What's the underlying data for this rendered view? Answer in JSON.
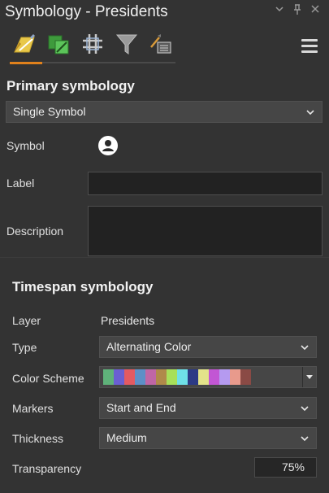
{
  "window": {
    "title": "Symbology - Presidents",
    "buttons": [
      "chevron-down-icon",
      "pin-icon",
      "close-icon"
    ]
  },
  "toolbar": {
    "tabs": [
      {
        "name": "primary-symbology-tab",
        "active": true
      },
      {
        "name": "secondary-symbology-tab",
        "active": false
      },
      {
        "name": "vary-symbology-tab",
        "active": false
      },
      {
        "name": "symbol-filter-tab",
        "active": false
      },
      {
        "name": "symbol-layer-drawing-tab",
        "active": false
      }
    ],
    "accent_color": "#e0811c"
  },
  "primary": {
    "heading": "Primary symbology",
    "method": "Single Symbol",
    "symbol_label": "Symbol",
    "label_label": "Label",
    "label_value": "",
    "description_label": "Description",
    "description_value": ""
  },
  "timespan": {
    "heading": "Timespan symbology",
    "layer_label": "Layer",
    "layer_value": "Presidents",
    "type_label": "Type",
    "type_value": "Alternating Color",
    "color_scheme_label": "Color Scheme",
    "color_scheme_swatches": [
      "#5fb27a",
      "#6a5fd2",
      "#e35a62",
      "#5d8fc7",
      "#c066a6",
      "#b08a4a",
      "#a7e05a",
      "#6fe0e8",
      "#2c3a85",
      "#e3e38a",
      "#c256d4",
      "#b59af0",
      "#e89a8c",
      "#8a4a45"
    ],
    "markers_label": "Markers",
    "markers_value": "Start and End",
    "thickness_label": "Thickness",
    "thickness_value": "Medium",
    "transparency_label": "Transparency",
    "transparency_value": "75%"
  }
}
